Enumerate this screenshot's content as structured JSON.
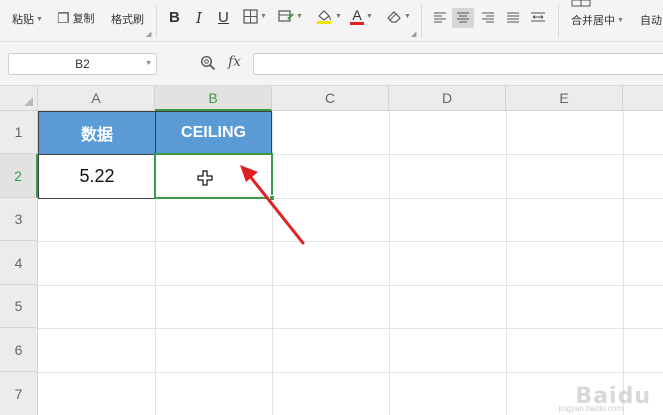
{
  "ribbon": {
    "paste_label": "粘贴",
    "copy_label": "复制",
    "format_painter_label": "格式刷",
    "bold": "B",
    "italic": "I",
    "underline": "U",
    "font_color_glyph": "A",
    "merge_center_label": "合并居中",
    "auto_wrap_label": "自动"
  },
  "formula_bar": {
    "name_box": "B2",
    "fx_label": "fx",
    "formula": ""
  },
  "sheet": {
    "columns": [
      "A",
      "B",
      "C",
      "D",
      "E"
    ],
    "rows": [
      "1",
      "2",
      "3",
      "4",
      "5",
      "6",
      "7"
    ],
    "active_column": "B",
    "active_row": "2",
    "header_fill_color": "#5b9bd5",
    "selection_color": "#3a9a48",
    "annotation_arrow_color": "#e02020",
    "cells": {
      "A1": "数据",
      "B1": "CEILING",
      "A2": "5.22",
      "B2": ""
    }
  },
  "watermark": {
    "brand": "Baidu",
    "sub": "jingyan.baidu.com"
  },
  "icons": {
    "copy": "copy-icon",
    "zoom": "zoom-icon",
    "border": "border-icon",
    "fill": "fill-color-icon",
    "eraser": "eraser-icon",
    "cell_cursor": "cell-cross-cursor-icon"
  }
}
